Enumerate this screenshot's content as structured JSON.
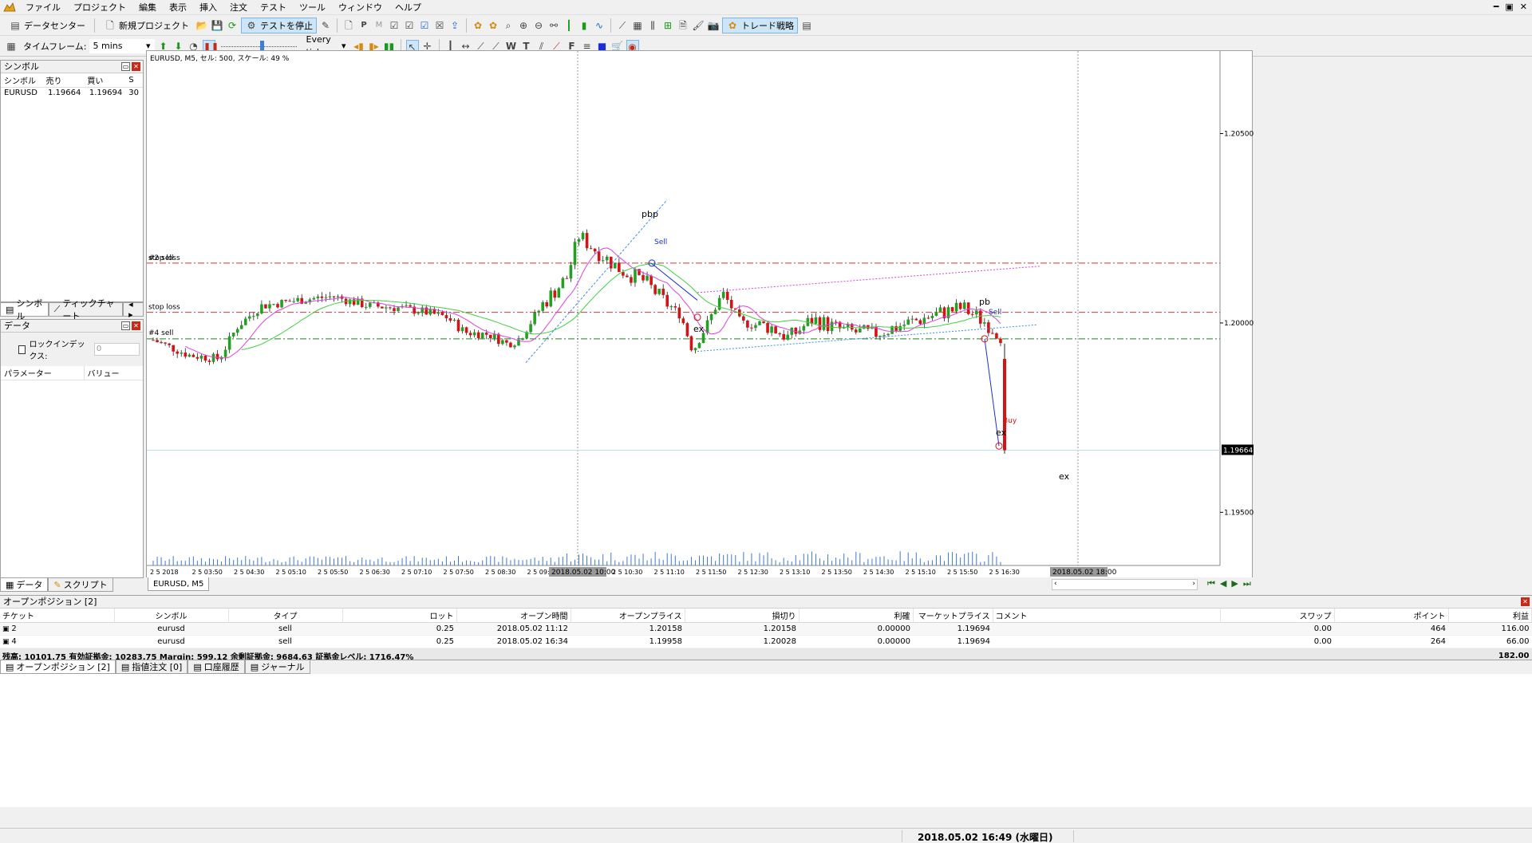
{
  "menu": {
    "items": [
      "ファイル",
      "プロジェクト",
      "編集",
      "表示",
      "挿入",
      "注文",
      "テスト",
      "ツール",
      "ウィンドウ",
      "ヘルプ"
    ],
    "window_controls": [
      "━",
      "▣",
      "✕"
    ]
  },
  "toolbar1": {
    "data_center": "データセンター",
    "new_project": "新規プロジェクト",
    "stop_test": "テストを停止",
    "trade_strategy": "トレード戦略"
  },
  "toolbar2": {
    "timeframe_label": "タイムフレーム:",
    "timeframe_value": "5 mins",
    "tick_mode": "Every tick",
    "speed_level": 0.55
  },
  "symbols_panel": {
    "title": "シンボル",
    "columns": [
      "シンボル",
      "売り",
      "買い",
      "S"
    ],
    "rows": [
      [
        "EURUSD",
        "1.19664",
        "1.19694",
        "30"
      ]
    ],
    "tabs": [
      "シンボル",
      "ティックチャート"
    ]
  },
  "data_panel": {
    "title": "データ",
    "lock_index_label": "ロックインデックス:",
    "lock_index_value": "0",
    "columns": [
      "パラメーター",
      "バリュー"
    ],
    "tabs": [
      "データ",
      "スクリプト"
    ]
  },
  "chart": {
    "header": "EURUSD, M5, セル: 500, スケール: 49 %",
    "tab_label": "EURUSD, M5",
    "current_price": "1.19664",
    "price_labels": [
      {
        "price": 1.205,
        "text": "1.20500"
      },
      {
        "price": 1.2,
        "text": "1.20000"
      },
      {
        "price": 1.195,
        "text": "1.19500"
      }
    ],
    "time_labels": [
      "2 5 2018",
      "2 5 03:50",
      "2 5 04:30",
      "2 5 05:10",
      "2 5 05:50",
      "2 5 06:30",
      "2 5 07:10",
      "2 5 07:50",
      "2 5 08:30",
      "2 5 09:10",
      "2 5 10:30",
      "2 5 11:10",
      "2 5 11:50",
      "2 5 12:30",
      "2 5 13:10",
      "2 5 13:50",
      "2 5 14:30",
      "2 5 15:10",
      "2 5 15:50",
      "2 5 16:30"
    ],
    "crosshair_time": "2018.05.02 10:00",
    "future_time": "2018.05.02 18:00",
    "level_labels": [
      "#2 sell",
      "stop loss",
      "stop loss",
      "#4 sell"
    ],
    "annotations": [
      "pbp",
      "Sell",
      "ex",
      "pb",
      "Sell",
      "Buy",
      "ex",
      "ex"
    ]
  },
  "positions": {
    "title": "オープンポジション [2]",
    "columns": [
      "チケット",
      "シンボル",
      "タイプ",
      "ロット",
      "オープン時間",
      "オープンプライス",
      "損切り",
      "利確",
      "マーケットプライス",
      "コメント",
      "スワップ",
      "ポイント",
      "利益"
    ],
    "rows": [
      [
        "2",
        "eurusd",
        "sell",
        "0.25",
        "2018.05.02 11:12",
        "1.20158",
        "1.20158",
        "0.00000",
        "1.19694",
        "",
        "0.00",
        "464",
        "116.00"
      ],
      [
        "4",
        "eurusd",
        "sell",
        "0.25",
        "2018.05.02 16:34",
        "1.19958",
        "1.20028",
        "0.00000",
        "1.19694",
        "",
        "0.00",
        "264",
        "66.00"
      ]
    ],
    "summary": "残高: 10101.75 有効証拠金: 10283.75 Margin: 599.12 余剰証拠金: 9684.63 証拠金レベル: 1716.47%",
    "summary_profit": "182.00",
    "tabs": [
      "オープンポジション [2]",
      "指値注文 [0]",
      "口座履歴",
      "ジャーナル"
    ]
  },
  "status": {
    "datetime": "2018.05.02 16:49 (水曜日)"
  },
  "colors": {
    "bull": "#23a023",
    "bear": "#d21414",
    "ma_fast": "#e040e0",
    "ma_slow": "#40d040",
    "level_red": "#e03030",
    "level_green": "#208020",
    "trend": "#3c8cff",
    "trade_line": "#1a2ed8"
  }
}
